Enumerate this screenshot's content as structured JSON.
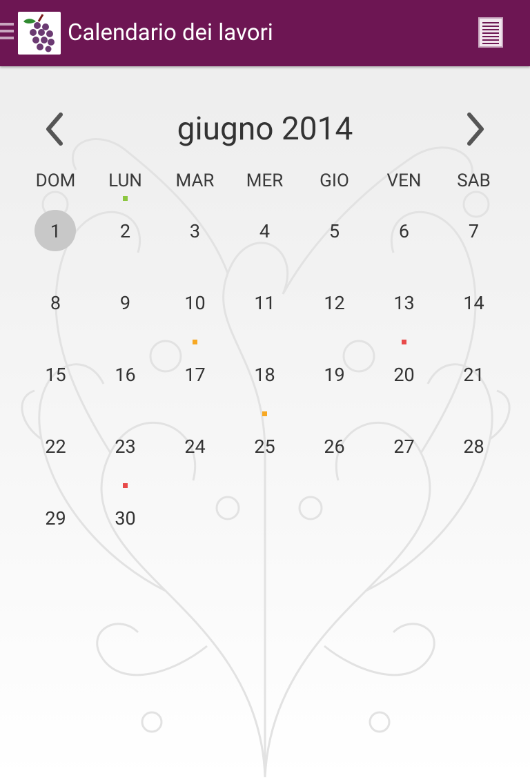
{
  "app_bar": {
    "title": "Calendario dei lavori",
    "logo_icon": "grape-bunch-icon",
    "menu_icon": "drawer-indicator-icon",
    "action_icon": "list-view-icon",
    "color": "#6d1653"
  },
  "calendar": {
    "month_label": "giugno 2014",
    "prev_icon": "chevron-left-icon",
    "next_icon": "chevron-right-icon",
    "weekdays": [
      "DOM",
      "LUN",
      "MAR",
      "MER",
      "GIO",
      "VEN",
      "SAB"
    ],
    "weeks": [
      [
        "1",
        "2",
        "3",
        "4",
        "5",
        "6",
        "7"
      ],
      [
        "8",
        "9",
        "10",
        "11",
        "12",
        "13",
        "14"
      ],
      [
        "15",
        "16",
        "17",
        "18",
        "19",
        "20",
        "21"
      ],
      [
        "22",
        "23",
        "24",
        "25",
        "26",
        "27",
        "28"
      ],
      [
        "29",
        "30",
        "",
        "",
        "",
        "",
        ""
      ]
    ],
    "selected_day": "1",
    "event_markers": [
      {
        "day": "2",
        "color": "#8cc63f"
      },
      {
        "day": "17",
        "color": "#f7a823"
      },
      {
        "day": "20",
        "color": "#e84a4a"
      },
      {
        "day": "25",
        "color": "#f7a823"
      },
      {
        "day": "30",
        "color": "#e84a4a"
      }
    ]
  }
}
